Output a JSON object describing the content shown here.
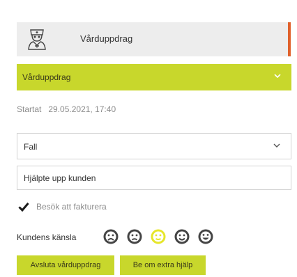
{
  "header": {
    "title": "Vårduppdrag",
    "icon": "nurse-icon",
    "accent_color": "#e0602a"
  },
  "task_dropdown": {
    "selected": "Vårduppdrag",
    "color": "#c8d72c"
  },
  "started": {
    "label": "Startat",
    "value": "29.05.2021, 17:40"
  },
  "reason_select": {
    "selected": "Fall"
  },
  "note_input": {
    "value": "Hjälpte upp kunden"
  },
  "invoice_checkbox": {
    "label": "Besök att fakturera",
    "checked": true
  },
  "feeling": {
    "label": "Kundens känsla",
    "options": [
      "very-sad-face-icon",
      "sad-face-icon",
      "neutral-face-icon",
      "happy-face-icon",
      "very-happy-face-icon"
    ],
    "selected_index": 2,
    "selected_color": "#e6e62a"
  },
  "buttons": {
    "end_task": "Avsluta vårduppdrag",
    "extra_help": "Be om extra hjälp"
  }
}
